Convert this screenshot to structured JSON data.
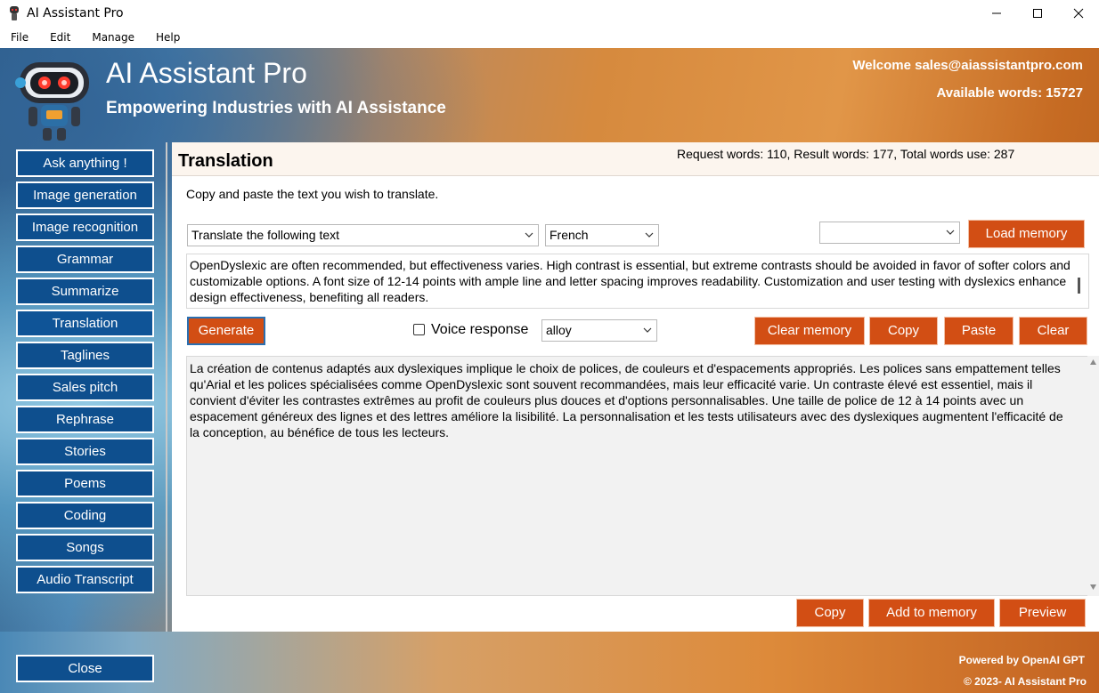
{
  "window": {
    "title": "AI Assistant Pro"
  },
  "menu": [
    "File",
    "Edit",
    "Manage",
    "Help"
  ],
  "header": {
    "app_name": "AI Assistant Pro",
    "tagline": "Empowering Industries with AI Assistance",
    "welcome": "Welcome sales@aiassistantpro.com",
    "available_words": "Available words: 15727"
  },
  "sidebar": {
    "items": [
      {
        "label": "Ask anything !"
      },
      {
        "label": "Image generation"
      },
      {
        "label": "Image recognition"
      },
      {
        "label": "Grammar"
      },
      {
        "label": "Summarize"
      },
      {
        "label": "Translation"
      },
      {
        "label": "Taglines"
      },
      {
        "label": "Sales pitch"
      },
      {
        "label": "Rephrase"
      },
      {
        "label": "Stories"
      },
      {
        "label": "Poems"
      },
      {
        "label": "Coding"
      },
      {
        "label": "Songs"
      },
      {
        "label": "Audio Transcript"
      }
    ],
    "close_label": "Close",
    "active_index": 5
  },
  "panel": {
    "title": "Translation",
    "word_stats": "Request words: 110, Result words: 177, Total words use: 287",
    "instruction": "Copy and paste the text you wish to translate.",
    "prompt_select": "Translate the following text",
    "language_select": "French",
    "memory_select": "",
    "load_memory_label": "Load memory",
    "input_text": "OpenDyslexic are often recommended, but effectiveness varies. High contrast is essential, but extreme contrasts should be avoided in favor of softer colors and customizable options. A font size of 12-14 points with ample line and letter spacing improves readability. Customization and user testing with dyslexics enhance design effectiveness, benefiting all readers.",
    "generate_label": "Generate",
    "voice_label": "Voice response",
    "voice_checked": false,
    "voice_select": "alloy",
    "clear_memory_label": "Clear memory",
    "copy_label": "Copy",
    "paste_label": "Paste",
    "clear_label": "Clear",
    "output_text": "La création de contenus adaptés aux dyslexiques implique le choix de polices, de couleurs et d'espacements appropriés. Les polices sans empattement telles qu'Arial et les polices spécialisées comme OpenDyslexic sont souvent recommandées, mais leur efficacité varie. Un contraste élevé est essentiel, mais il convient d'éviter les contrastes extrêmes au profit de couleurs plus douces et d'options personnalisables. Une taille de police de 12 à 14 points avec un espacement généreux des lignes et des lettres améliore la lisibilité. La personnalisation et les tests utilisateurs avec des dyslexiques augmentent l'efficacité de la conception, au bénéfice de tous les lecteurs.",
    "out_copy_label": "Copy",
    "add_memory_label": "Add to memory",
    "preview_label": "Preview"
  },
  "footer": {
    "powered": "Powered by OpenAI GPT",
    "copyright": "© 2023-  AI Assistant Pro"
  },
  "colors": {
    "sidebar_button": "#0e4f8e",
    "action_button": "#d24e14",
    "panel_header": "#fcf5ee"
  }
}
